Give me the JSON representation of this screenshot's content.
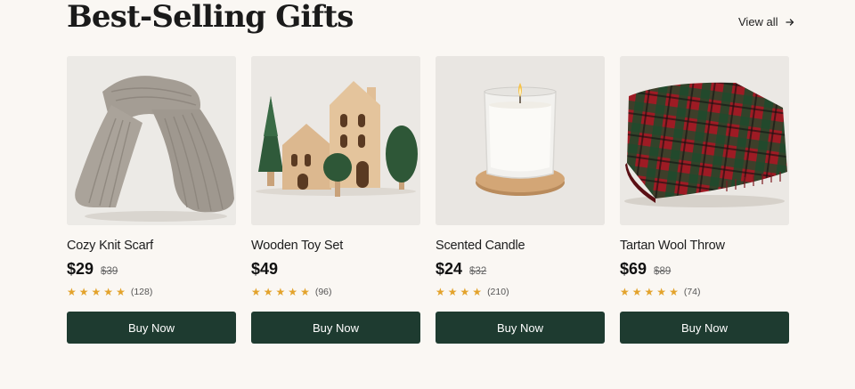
{
  "section": {
    "title": "Best-Selling Gifts",
    "view_all_label": "View all"
  },
  "products": [
    {
      "name": "Cozy Knit Scarf",
      "price": "$29",
      "old_price": "$39",
      "rating": 5,
      "review_count": "(128)",
      "button_label": "Buy Now",
      "image": "scarf-image"
    },
    {
      "name": "Wooden Toy Set",
      "price": "$49",
      "old_price": "",
      "rating": 5,
      "review_count": "(96)",
      "button_label": "Buy Now",
      "image": "wooden-toy-image"
    },
    {
      "name": "Scented Candle",
      "price": "$24",
      "old_price": "$32",
      "rating": 4,
      "review_count": "(210)",
      "button_label": "Buy Now",
      "image": "candle-image"
    },
    {
      "name": "Tartan Wool Throw",
      "price": "$69",
      "old_price": "$89",
      "rating": 5,
      "review_count": "(74)",
      "button_label": "Buy Now",
      "image": "tartan-throw-image"
    }
  ],
  "colors": {
    "background": "#faf7f3",
    "button": "#1e3b30",
    "star": "#e3a32c"
  }
}
